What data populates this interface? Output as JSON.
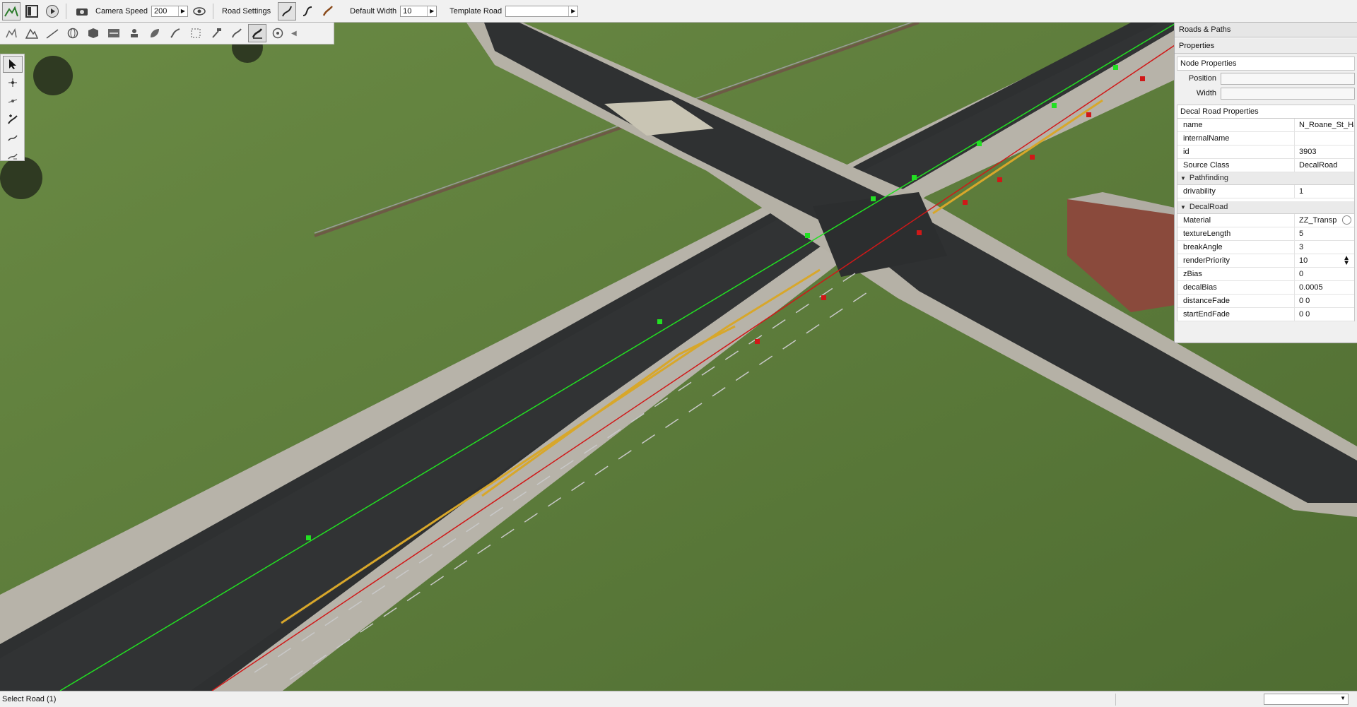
{
  "toolbar": {
    "camera_speed_label": "Camera Speed",
    "camera_speed_value": "200",
    "road_settings_label": "Road Settings",
    "default_width_label": "Default Width",
    "default_width_value": "10",
    "template_road_label": "Template Road",
    "template_road_value": ""
  },
  "right_panel": {
    "title": "Roads & Paths",
    "properties_label": "Properties",
    "node_properties": {
      "header": "Node Properties",
      "position_label": "Position",
      "width_label": "Width"
    },
    "decal_road_properties": {
      "header": "Decal Road Properties",
      "general": [
        {
          "key": "name",
          "value": "N_Roane_St_Hai"
        },
        {
          "key": "internalName",
          "value": ""
        },
        {
          "key": "id",
          "value": "3903"
        },
        {
          "key": "Source Class",
          "value": "DecalRoad"
        }
      ],
      "pathfinding_label": "Pathfinding",
      "pathfinding": [
        {
          "key": "drivability",
          "value": "1"
        }
      ],
      "decalroad_label": "DecalRoad",
      "decalroad": [
        {
          "key": "Material",
          "value": "ZZ_Transp"
        },
        {
          "key": "textureLength",
          "value": "5"
        },
        {
          "key": "breakAngle",
          "value": "3"
        },
        {
          "key": "renderPriority",
          "value": "10"
        },
        {
          "key": "zBias",
          "value": "0"
        },
        {
          "key": "decalBias",
          "value": "0.0005"
        },
        {
          "key": "distanceFade",
          "value": "0 0"
        },
        {
          "key": "startEndFade",
          "value": "0 0"
        }
      ]
    }
  },
  "statusbar": {
    "status_text": "Select Road (1)",
    "combo_value": ""
  },
  "colors": {
    "toolbar_bg": "#f1f1f1",
    "grass": "#5a7a3a",
    "road": "#2d2f30",
    "sidewalk": "#b9b6ad",
    "green_spline": "#22e022",
    "red_spline": "#d01818",
    "lane_yellow": "#d8a72a"
  }
}
